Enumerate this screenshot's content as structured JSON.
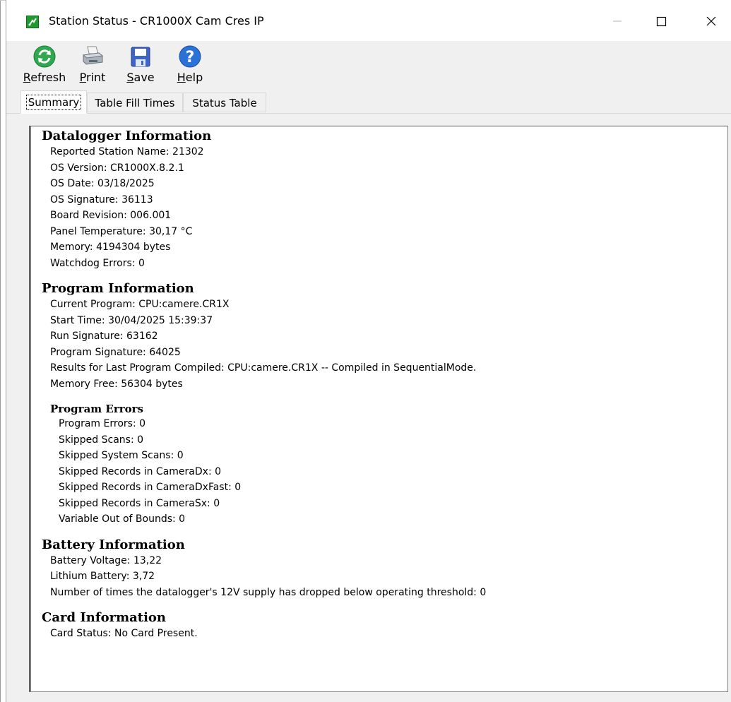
{
  "window": {
    "title": "Station Status - CR1000X Cam Cres IP",
    "controls": {
      "minimize": "—",
      "maximize": "□",
      "close": "✕"
    }
  },
  "toolbar": {
    "refresh": {
      "prefix": "",
      "underlined": "R",
      "rest": "efresh",
      "icon": "refresh-icon"
    },
    "print": {
      "prefix": "",
      "underlined": "P",
      "rest": "rint",
      "icon": "printer-icon"
    },
    "save": {
      "prefix": "",
      "underlined": "S",
      "rest": "ave",
      "icon": "floppy-disk-icon"
    },
    "help": {
      "prefix": "",
      "underlined": "H",
      "rest": "elp",
      "icon": "help-icon"
    }
  },
  "tabs": [
    {
      "label": "Summary",
      "active": true
    },
    {
      "label": "Table Fill Times",
      "active": false
    },
    {
      "label": "Status Table",
      "active": false
    }
  ],
  "summary": {
    "datalogger": {
      "heading": "Datalogger Information",
      "lines": [
        "Reported Station Name: 21302",
        "OS Version: CR1000X.8.2.1",
        "OS Date: 03/18/2025",
        "OS Signature: 36113",
        "Board Revision: 006.001",
        "Panel Temperature: 30,17 °C",
        "Memory: 4194304 bytes",
        "Watchdog Errors: 0"
      ]
    },
    "program": {
      "heading": "Program Information",
      "lines": [
        "Current Program: CPU:camere.CR1X",
        "Start Time: 30/04/2025 15:39:37",
        "Run Signature: 63162",
        "Program Signature: 64025",
        "Results for Last Program Compiled: CPU:camere.CR1X -- Compiled in SequentialMode.",
        "Memory Free: 56304 bytes"
      ]
    },
    "program_errors": {
      "heading": "Program Errors",
      "lines": [
        "Program Errors: 0",
        "Skipped Scans: 0",
        "Skipped System Scans: 0",
        "Skipped Records in CameraDx:  0",
        "Skipped Records in CameraDxFast:  0",
        "Skipped Records in CameraSx:  0",
        "Variable Out of Bounds: 0"
      ]
    },
    "battery": {
      "heading": "Battery Information",
      "lines": [
        "Battery Voltage: 13,22",
        "Lithium Battery: 3,72",
        "Number of times the datalogger's 12V supply has dropped below operating threshold: 0"
      ]
    },
    "card": {
      "heading": "Card Information",
      "lines": [
        "Card Status: No Card Present."
      ]
    }
  },
  "colors": {
    "window_bg": "#f0f0f0",
    "panel_bg": "#ffffff",
    "app_icon": "#1e9a2e",
    "refresh_green": "#2fa84f",
    "help_blue": "#2a72d6",
    "save_blue": "#3e64c8"
  }
}
